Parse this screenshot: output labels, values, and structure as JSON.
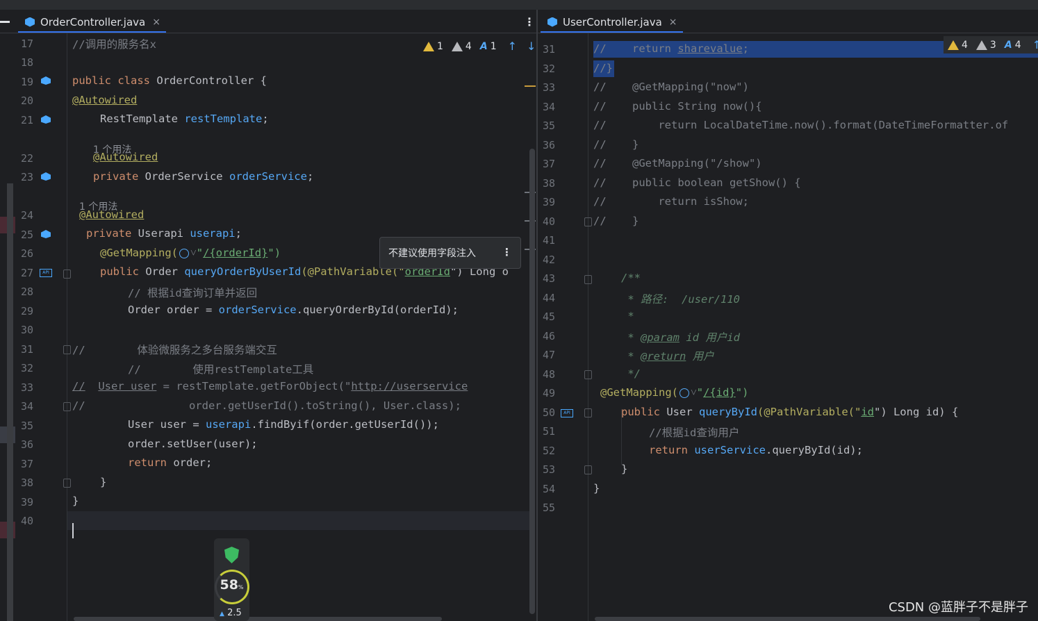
{
  "left_tab": {
    "title": "OrderController.java",
    "close": "×"
  },
  "right_tab": {
    "title": "UserController.java",
    "close": "×"
  },
  "left_inspections": {
    "warn_count": "1",
    "weak_warn_count": "4",
    "typo_count": "1"
  },
  "right_inspections": {
    "warn_count": "4",
    "weak_warn_count": "3",
    "typo_count": "4"
  },
  "left_lines": [
    "17",
    "18",
    "19",
    "20",
    "21",
    "22",
    "23",
    "24",
    "25",
    "26",
    "27",
    "28",
    "29",
    "30",
    "31",
    "32",
    "33",
    "34",
    "35",
    "36",
    "37",
    "38",
    "39",
    "40"
  ],
  "right_lines": [
    "31",
    "32",
    "33",
    "34",
    "35",
    "36",
    "37",
    "38",
    "39",
    "40",
    "41",
    "42",
    "43",
    "44",
    "45",
    "46",
    "47",
    "48",
    "49",
    "50",
    "51",
    "52",
    "53",
    "54",
    "55"
  ],
  "usage_hint_1": "1 个用法",
  "usage_hint_2": "1 个用法",
  "tooltip": {
    "text": "不建议使用字段注入",
    "menu": "⋮"
  },
  "left_code": {
    "l17": "//调用的服务名x",
    "l19a": "public class ",
    "l19b": "OrderController {",
    "l20": "@Autowired",
    "l21a": "RestTemplate ",
    "l21b": "restTemplate",
    "l21c": ";",
    "l22": "@Autowired",
    "l23a": "private ",
    "l23b": "OrderService ",
    "l23c": "orderService",
    "l23d": ";",
    "l24": "@Autowired",
    "l25a": "private ",
    "l25b": "Userapi ",
    "l25c": "userapi",
    "l25d": ";",
    "l26a": "@GetMapping(",
    "l26b": "\"",
    "l26c": "/{orderId}",
    "l26d": "\")",
    "l27a": "public ",
    "l27b": "Order ",
    "l27c": "queryOrderByUserId",
    "l27d": "(@PathVariable(\"",
    "l27e": "orderId",
    "l27f": "\") Long o",
    "l28": "// 根据id查询订单并返回",
    "l29a": "Order order = ",
    "l29b": "orderService",
    "l29c": ".queryOrderById(orderId);",
    "l31a": "//",
    "l31b": "        体验微服务之多台服务端交互",
    "l32": "//        使用restTemplate工具",
    "l33a": "//",
    "l33b": "User user",
    "l33c": " = restTemplate.getForObject(\"",
    "l33d": "http://userservice",
    "l34a": "//",
    "l34b": "                order.getUserId().toString(), User.class);",
    "l35a": "User user = ",
    "l35b": "userapi",
    "l35c": ".findByif(order.getUserId());",
    "l36": "order.setUser(user);",
    "l37a": "return ",
    "l37b": "order;",
    "l38": "}",
    "l39": "}"
  },
  "right_code": {
    "l31a": "//    return ",
    "l31b": "sharevalue",
    "l31c": ";",
    "l32": "//}",
    "l33": "//    @GetMapping(\"now\")",
    "l34": "//    public String now(){",
    "l35": "//        return LocalDateTime.now().format(DateTimeFormatter.of",
    "l36": "//    }",
    "l37": "//    @GetMapping(\"/show\")",
    "l38": "//    public boolean getShow() {",
    "l39": "//        return isShow;",
    "l40": "//    }",
    "l43": "/**",
    "l44": " * 路径:  /user/110",
    "l45": " *",
    "l46a": " * ",
    "l46b": "@param",
    "l46c": " id 用户id",
    "l47a": " * ",
    "l47b": "@return",
    "l47c": " 用户",
    "l48": " */",
    "l49a": "@GetMapping(",
    "l49b": "\"",
    "l49c": "/{id}",
    "l49d": "\")",
    "l50a": "public ",
    "l50b": "User ",
    "l50c": "queryById",
    "l50d": "(@PathVariable(\"",
    "l50e": "id",
    "l50f": "\") Long id) {",
    "l51": "//根据id查询用户",
    "l52a": "return ",
    "l52b": "userService",
    "l52c": ".queryById(id);",
    "l53": "}",
    "l54": "}"
  },
  "widget": {
    "percent": "58",
    "percent_sign": "%",
    "speed": "2.5"
  },
  "watermark": "CSDN @蓝胖子不是胖子",
  "colors": {
    "keyword": "#cf8e6d",
    "field": "#56a8f5",
    "annotation": "#b3ae60",
    "comment": "#7a7e85",
    "string": "#6aab73",
    "doc": "#5f826b",
    "selection": "#214283"
  }
}
